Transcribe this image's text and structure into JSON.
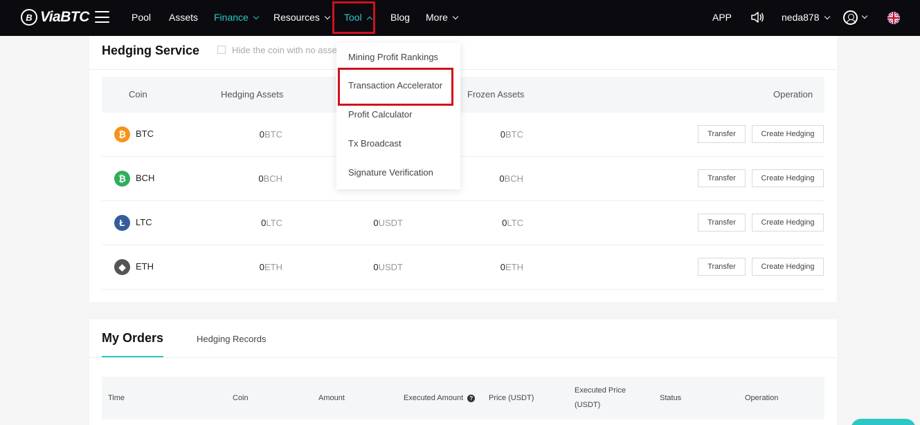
{
  "brand": {
    "logo_text": "ViaBTC",
    "logo_mark": "B"
  },
  "nav": {
    "pool": "Pool",
    "assets": "Assets",
    "finance": "Finance",
    "resources": "Resources",
    "tool": "Tool",
    "blog": "Blog",
    "more": "More",
    "app": "APP",
    "username": "neda878"
  },
  "colors": {
    "accent": "#2cc7c5",
    "highlight": "#d0121b",
    "nav_bg": "#0b0b0f"
  },
  "icons": [
    "hamburger-icon",
    "speaker-icon",
    "user-icon",
    "uk-flag-icon",
    "chevron-down-icon",
    "chevron-up-icon"
  ],
  "hedging": {
    "title": "Hedging Service",
    "hide_label": "Hide the coin with no asse",
    "columns": {
      "coin": "Coin",
      "hedging_assets": "Hedging Assets",
      "frozen_assets": "Frozen Assets",
      "operation": "Operation"
    },
    "transfer_label": "Transfer",
    "create_label": "Create Hedging",
    "rows": [
      {
        "coin": "BTC",
        "icon": "₿",
        "color": "#f7931a",
        "hedging_val": "0",
        "hedging_unit": "BTC",
        "mid_val": "",
        "mid_unit": "",
        "frozen_val": "0",
        "frozen_unit": "BTC"
      },
      {
        "coin": "BCH",
        "icon": "₿",
        "color": "#2fae5b",
        "hedging_val": "0",
        "hedging_unit": "BCH",
        "mid_val": "",
        "mid_unit": "",
        "frozen_val": "0",
        "frozen_unit": "BCH"
      },
      {
        "coin": "LTC",
        "icon": "Ł",
        "color": "#345d9d",
        "hedging_val": "0",
        "hedging_unit": "LTC",
        "mid_val": "0",
        "mid_unit": "USDT",
        "frozen_val": "0",
        "frozen_unit": "LTC"
      },
      {
        "coin": "ETH",
        "icon": "◆",
        "color": "#555555",
        "hedging_val": "0",
        "hedging_unit": "ETH",
        "mid_val": "0",
        "mid_unit": "USDT",
        "frozen_val": "0",
        "frozen_unit": "ETH"
      }
    ]
  },
  "tool_menu": {
    "items": [
      "Mining Profit Rankings",
      "Transaction Accelerator",
      "Profit Calculator",
      "Tx Broadcast",
      "Signature Verification"
    ]
  },
  "orders": {
    "tab_my_orders": "My Orders",
    "tab_records": "Hedging Records",
    "columns": {
      "time": "Time",
      "coin": "Coin",
      "amount": "Amount",
      "executed_amount": "Executed Amount",
      "price": "Price (USDT)",
      "executed_price_1": "Executed Price",
      "executed_price_2": "(USDT)",
      "status": "Status",
      "operation": "Operation"
    }
  }
}
